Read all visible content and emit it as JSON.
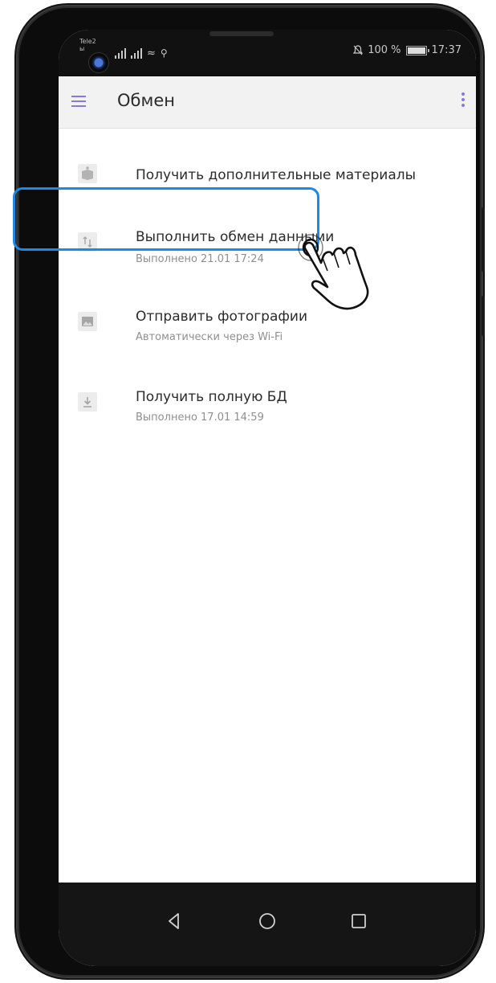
{
  "status_bar": {
    "carrier": "Tele2",
    "carrier_sub": "ы",
    "battery_percent": "100 %",
    "time": "17:37"
  },
  "app_bar": {
    "title": "Обмен"
  },
  "menu_items": [
    {
      "title": "Получить дополнительные материалы",
      "subtitle": "",
      "icon": "book-icon"
    },
    {
      "title": "Выполнить обмен данными",
      "subtitle": "Выполнено 21.01 17:24",
      "icon": "sync-arrows-icon"
    },
    {
      "title": "Отправить фотографии",
      "subtitle": "Автоматически через Wi-Fi",
      "icon": "image-icon"
    },
    {
      "title": "Получить полную БД",
      "subtitle": "Выполнено 17.01 14:59",
      "icon": "download-icon"
    }
  ],
  "colors": {
    "accent": "#8a7ad6",
    "highlight": "#1e88e5",
    "status_bar_bg": "#111111",
    "app_bar_bg": "#f2f2f2"
  }
}
